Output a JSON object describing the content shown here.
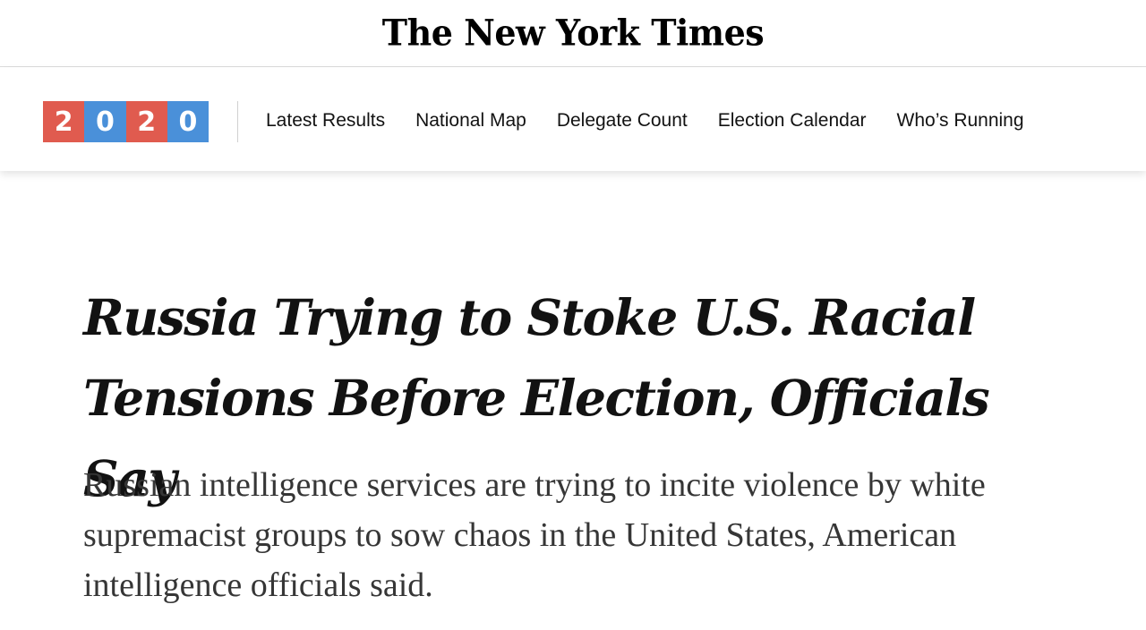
{
  "masthead": {
    "logo_text": "The New York Times"
  },
  "election_bar": {
    "badge": {
      "digits": [
        "2",
        "0",
        "2",
        "0"
      ],
      "colors": [
        "#e05b4f",
        "#4a90d9",
        "#e05b4f",
        "#4a90d9"
      ]
    },
    "nav_items": [
      "Latest Results",
      "National Map",
      "Delegate Count",
      "Election Calendar",
      "Who’s Running"
    ]
  },
  "article": {
    "headline": "Russia Trying to Stoke U.S. Racial Tensions Before Election, Officials Say",
    "summary": "Russian intelligence services are trying to incite violence by white supremacist groups to sow chaos in the United States, American intelligence officials said."
  }
}
